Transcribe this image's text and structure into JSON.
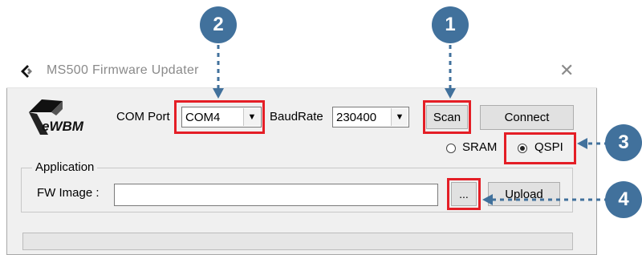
{
  "window": {
    "title": "MS500 Firmware Updater",
    "close_glyph": "✕"
  },
  "logo": {
    "text": "eWBM"
  },
  "com": {
    "label": "COM Port",
    "value": "COM4"
  },
  "baud": {
    "label": "BaudRate",
    "value": "230400"
  },
  "buttons": {
    "scan": "Scan",
    "connect": "Connect",
    "browse": "...",
    "upload": "Upload"
  },
  "memory": {
    "sram": "SRAM",
    "qspi": "QSPI",
    "selected": "QSPI"
  },
  "application": {
    "group_title": "Application",
    "fw_label": "FW Image :",
    "fw_value": ""
  },
  "progress": {
    "value": 0
  },
  "annotations": {
    "badge_1": "1",
    "badge_2": "2",
    "badge_3": "3",
    "badge_4": "4",
    "highlight_color": "#e41e26",
    "badge_color": "#41719c"
  }
}
